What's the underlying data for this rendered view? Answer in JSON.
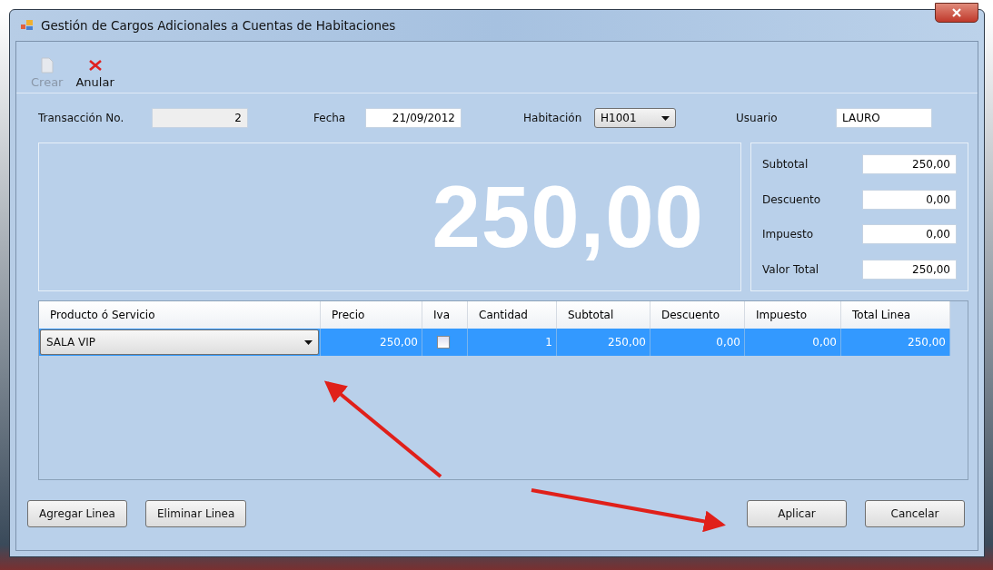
{
  "window": {
    "title": "Gestión de Cargos Adicionales a Cuentas de Habitaciones"
  },
  "toolbar": [
    {
      "kind": "new",
      "label": "Crear",
      "disabled": true
    },
    {
      "kind": "cancel",
      "label": "Anular",
      "disabled": false
    }
  ],
  "header": {
    "transaction": {
      "label": "Transacción No.",
      "value": "2"
    },
    "date": {
      "label": "Fecha",
      "value": "21/09/2012"
    },
    "room": {
      "label": "Habitación",
      "value": "H1001"
    },
    "user": {
      "label": "Usuario",
      "value": "LAURO"
    }
  },
  "display": "250,00",
  "totals": [
    {
      "label": "Subtotal",
      "value": "250,00"
    },
    {
      "label": "Descuento",
      "value": "0,00"
    },
    {
      "label": "Impuesto",
      "value": "0,00"
    },
    {
      "label": "Valor Total",
      "value": "250,00"
    }
  ],
  "grid": {
    "columns": [
      "Producto ó Servicio",
      "Precio",
      "Iva",
      "Cantidad",
      "Subtotal",
      "Descuento",
      "Impuesto",
      "Total Linea"
    ],
    "rows": [
      {
        "selected": true,
        "product": "SALA VIP",
        "price": "250,00",
        "iva": false,
        "quantity": "1",
        "subtotal": "250,00",
        "discount": "0,00",
        "tax": "0,00",
        "total": "250,00"
      }
    ]
  },
  "buttons_left": [
    "Agregar Linea",
    "Eliminar Linea"
  ],
  "buttons_right": [
    "Aplicar",
    "Cancelar"
  ]
}
